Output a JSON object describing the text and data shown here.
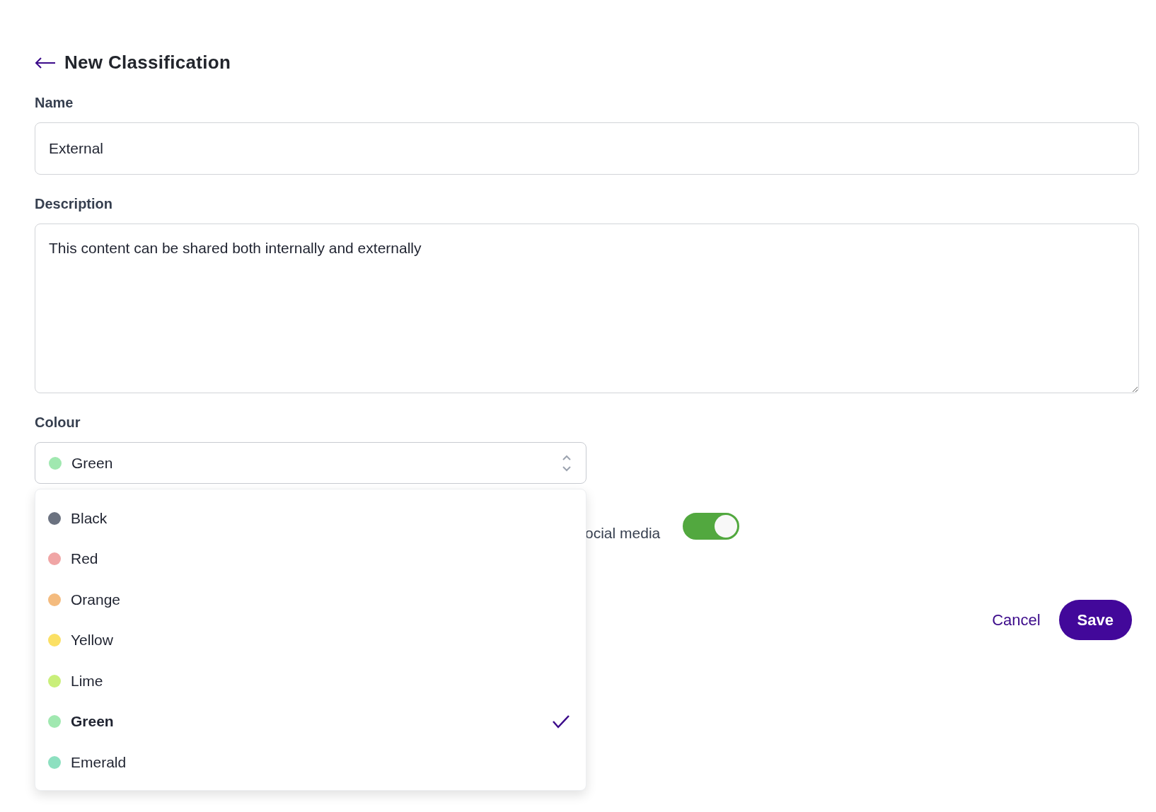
{
  "header": {
    "title": "New Classification"
  },
  "name_field": {
    "label": "Name",
    "value": "External"
  },
  "description_field": {
    "label": "Description",
    "value": "This content can be shared both internally and externally"
  },
  "colour_select": {
    "label": "Colour",
    "value": "Green",
    "color": "#a0e8b0",
    "expanded": true,
    "options": [
      {
        "label": "Black",
        "color": "#6b7280",
        "selected": false
      },
      {
        "label": "Red",
        "color": "#f0a5a5",
        "selected": false
      },
      {
        "label": "Orange",
        "color": "#f4bb7e",
        "selected": false
      },
      {
        "label": "Yellow",
        "color": "#fbe064",
        "selected": false
      },
      {
        "label": "Lime",
        "color": "#c9ef7a",
        "selected": false
      },
      {
        "label": "Green",
        "color": "#a0e8b0",
        "selected": true
      },
      {
        "label": "Emerald",
        "color": "#8de0c0",
        "selected": false
      }
    ]
  },
  "social_toggle": {
    "label": "ocial media",
    "on": true
  },
  "buttons": [
    {
      "label": "Cancel",
      "kind": "link"
    },
    {
      "label": "Save",
      "kind": "primary"
    }
  ]
}
